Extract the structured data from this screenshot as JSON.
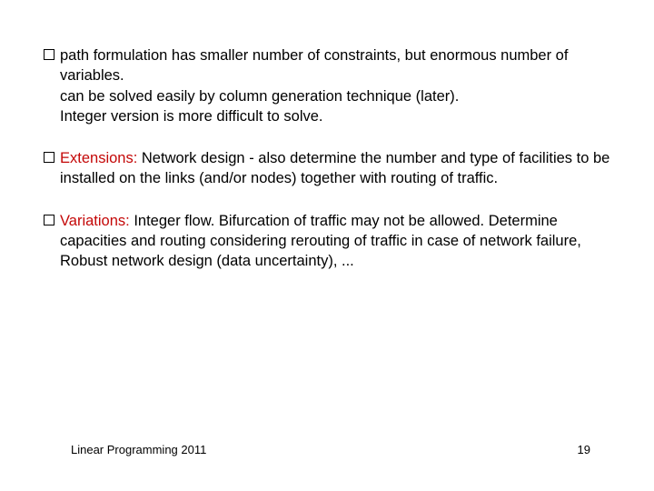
{
  "bullets": [
    {
      "lead": "",
      "lead_space": "",
      "first": "path formulation has smaller number of constraints, but enormous number of variables.",
      "lines": [
        "can be solved easily by column generation technique (later).",
        " Integer version is more difficult to solve."
      ]
    },
    {
      "lead": "Extensions:",
      "lead_space": "  ",
      "first": "Network design - also determine the number and type of facilities to be installed on the links (and/or nodes) together with routing of traffic.",
      "lines": []
    },
    {
      "lead": "Variations:",
      "lead_space": "  ",
      "first": "Integer flow. Bifurcation of traffic may not be allowed. Determine capacities and routing considering rerouting of traffic in case of network failure, Robust network design (data uncertainty), ...",
      "lines": []
    }
  ],
  "footer": {
    "left": "Linear Programming 2011",
    "right": "19"
  }
}
